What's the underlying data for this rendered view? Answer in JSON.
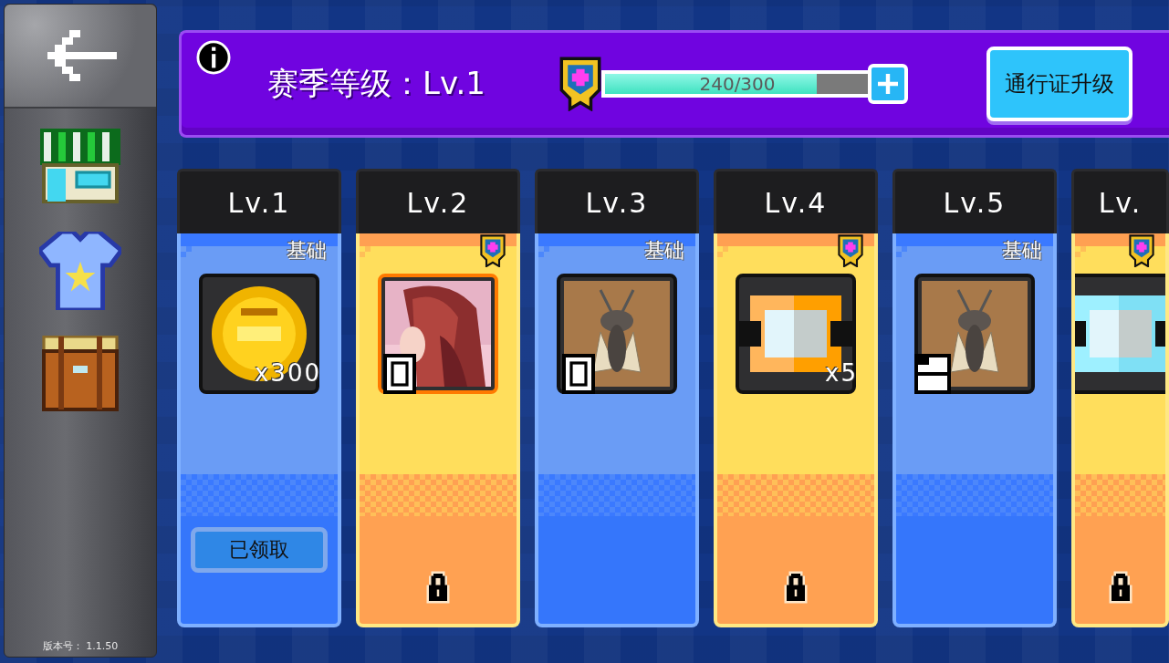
{
  "sidebar": {
    "items": [
      {
        "kind": "back"
      },
      {
        "kind": "shop"
      },
      {
        "kind": "shirt"
      },
      {
        "kind": "backpack"
      }
    ],
    "version": "版本号： 1.1.50"
  },
  "season_bar": {
    "title": "赛季等级：Lv.1",
    "progress": {
      "level": 0.8,
      "reading": "240/300"
    },
    "upgrade_button": "通行证升级"
  },
  "levels": [
    {
      "label": "Lv.1",
      "kind": "basic",
      "tag": "基础",
      "item": {
        "kind": "coin",
        "count": "x300",
        "fragment": false
      },
      "claim_button": "已领取",
      "locked": false
    },
    {
      "label": "Lv.2",
      "kind": "premium",
      "item": {
        "kind": "portrait",
        "fragment": true,
        "stacked": false
      },
      "locked": true
    },
    {
      "label": "Lv.3",
      "kind": "basic",
      "tag": "基础",
      "item": {
        "kind": "cicada",
        "fragment": true,
        "stacked": false
      },
      "locked": false
    },
    {
      "label": "Lv.4",
      "kind": "premium",
      "item": {
        "kind": "ticket",
        "count": "x5",
        "fragment": false
      },
      "locked": true
    },
    {
      "label": "Lv.5",
      "kind": "basic",
      "tag": "基础",
      "item": {
        "kind": "cicada",
        "fragment": true,
        "stacked": true
      },
      "locked": false
    },
    {
      "label": "Lv.",
      "kind": "premium",
      "item": {
        "kind": "ticket-cyan",
        "fragment": false
      },
      "locked": true
    }
  ]
}
